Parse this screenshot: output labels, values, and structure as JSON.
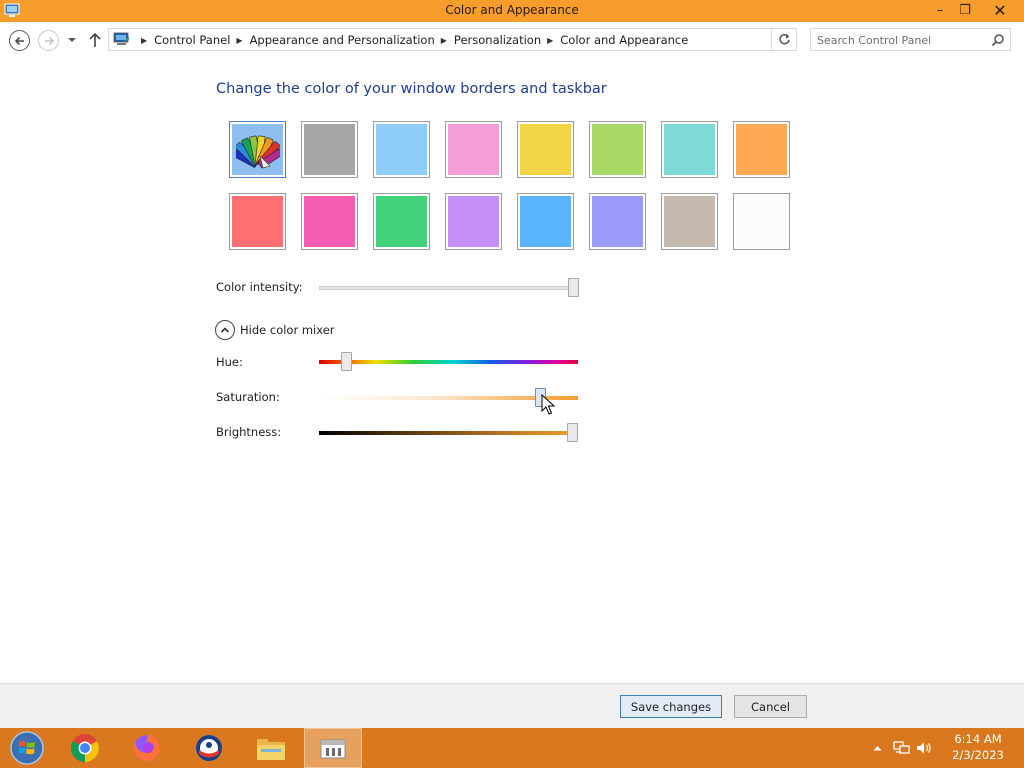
{
  "window": {
    "title": "Color and Appearance",
    "controls": {
      "minimize": "–",
      "maximize": "❐",
      "close": "✕"
    }
  },
  "address_bar": {
    "breadcrumbs": [
      "Control Panel",
      "Appearance and Personalization",
      "Personalization",
      "Color and Appearance"
    ],
    "search_placeholder": "Search Control Panel"
  },
  "content": {
    "heading": "Change the color of your window borders and taskbar",
    "swatches": [
      {
        "name": "automatic",
        "color": "#8fbff0",
        "selected": true
      },
      {
        "name": "gray",
        "color": "#a6a6a6"
      },
      {
        "name": "sky-blue",
        "color": "#8ecdfb"
      },
      {
        "name": "pink",
        "color": "#f39fd7"
      },
      {
        "name": "yellow",
        "color": "#f0d443"
      },
      {
        "name": "lime",
        "color": "#a8d964"
      },
      {
        "name": "teal",
        "color": "#7edad6"
      },
      {
        "name": "orange",
        "color": "#ffa955"
      },
      {
        "name": "red",
        "color": "#ff6f72"
      },
      {
        "name": "magenta",
        "color": "#f65eb3"
      },
      {
        "name": "green",
        "color": "#43d17a"
      },
      {
        "name": "violet",
        "color": "#c490f7"
      },
      {
        "name": "blue",
        "color": "#59b3fd"
      },
      {
        "name": "periwinkle",
        "color": "#9b9bfb"
      },
      {
        "name": "taupe",
        "color": "#c5b8ae"
      },
      {
        "name": "white",
        "color": "#fbfbfb"
      }
    ],
    "color_intensity_label": "Color intensity:",
    "color_intensity_value": 1.0,
    "mixer_toggle_label": "Hide color mixer",
    "hue_label": "Hue:",
    "hue_value": 0.09,
    "saturation_label": "Saturation:",
    "saturation_value": 0.87,
    "brightness_label": "Brightness:",
    "brightness_value": 1.0,
    "accent_color": "#f79d2c"
  },
  "footer": {
    "save_label": "Save changes",
    "cancel_label": "Cancel"
  },
  "taskbar": {
    "items": [
      "start-button",
      "chrome",
      "firefox",
      "outlook",
      "file-explorer",
      "control-panel"
    ],
    "active_item": "control-panel",
    "time": "6:14 AM",
    "date": "2/3/2023"
  }
}
